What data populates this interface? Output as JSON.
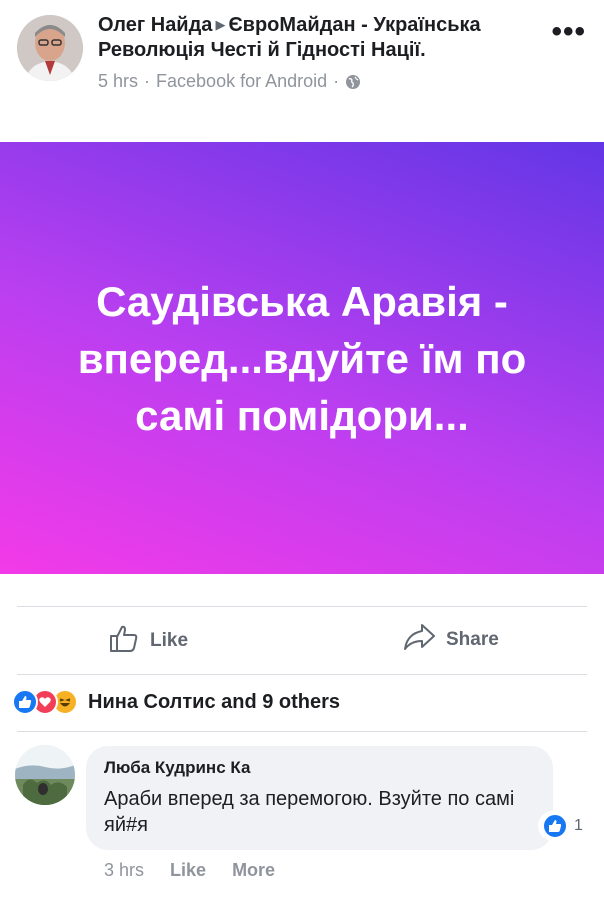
{
  "post": {
    "author": "Олег Найда",
    "group": "ЄвроМайдан - Українська Революція Честі й Гідності Нації.",
    "time": "5 hrs",
    "source": "Facebook for Android",
    "separator": "·"
  },
  "banner": {
    "text": "Саудівська Аравія - вперед...вдуйте їм по самі помідори..."
  },
  "actions": {
    "like_label": "Like",
    "share_label": "Share"
  },
  "reactions_summary": "Нина Солтис and 9 others",
  "comment": {
    "author": "Люба Кудринс Ка",
    "text": "Араби вперед за перемогою. Взуйте по самі яй#я",
    "reaction_count": "1",
    "time": "3 hrs",
    "like_label": "Like",
    "more_label": "More"
  },
  "icons": {
    "more": "more-options-icon",
    "globe": "globe-icon",
    "like": "thumbs-up-icon",
    "share": "share-arrow-icon"
  },
  "colors": {
    "brand_blue": "#1877f2",
    "love_red": "#f33e58",
    "haha_yellow": "#f7b125",
    "banner_gradient_start": "#f33ae8",
    "banner_gradient_end": "#6236e6"
  }
}
